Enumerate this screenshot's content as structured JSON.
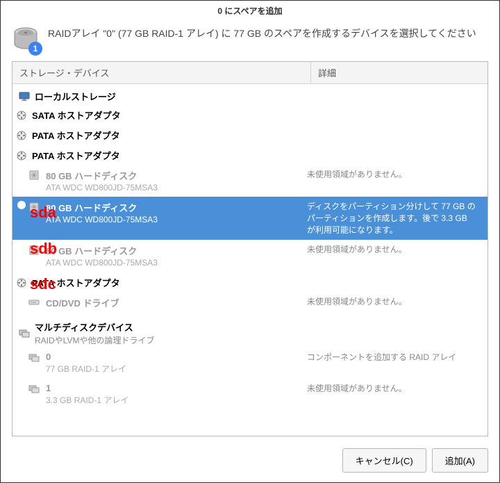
{
  "title": "0 にスペアを追加",
  "badge": "1",
  "header_text": "RAIDアレイ \"0\" (77 GB RAID-1 アレイ) に 77 GB のスペアを作成するデバイスを選択してください",
  "columns": {
    "storage": "ストレージ・デバイス",
    "details": "詳細"
  },
  "local_storage": "ローカルストレージ",
  "adapters": {
    "sata": "SATA ホストアダプタ",
    "pata1": "PATA ホストアダプタ",
    "pata2": "PATA ホストアダプタ",
    "pata3": "PATA ホストアダプタ"
  },
  "disks": {
    "sda": {
      "title": "80 GB ハードディスク",
      "sub": "ATA WDC WD800JD-75MSA3",
      "detail": "未使用領域がありません。"
    },
    "sdb": {
      "title": "80 GB ハードディスク",
      "sub": "ATA WDC WD800JD-75MSA3",
      "detail": "ディスクをパーティション分けして 77 GB のパーティションを作成します。後で 3.3 GB が利用可能になります。"
    },
    "sdc": {
      "title": "80 GB ハードディスク",
      "sub": "ATA WDC WD800JD-75MSA3",
      "detail": "未使用領域がありません。"
    }
  },
  "cdrom": {
    "title": "CD/DVD ドライブ",
    "detail": "未使用領域がありません。"
  },
  "multi": {
    "title": "マルチディスクデバイス",
    "sub": "RAIDやLVMや他の論理ドライブ",
    "arrays": [
      {
        "name": "0",
        "sub": "77 GB RAID-1 アレイ",
        "detail": "コンポーネントを追加する RAID アレイ"
      },
      {
        "name": "1",
        "sub": "3.3 GB RAID-1 アレイ",
        "detail": "未使用領域がありません。"
      }
    ]
  },
  "buttons": {
    "cancel": "キャンセル(C)",
    "add": "追加(A)"
  },
  "annotations": {
    "sda": "sda",
    "sdb": "sdb",
    "sdc": "sdc"
  }
}
